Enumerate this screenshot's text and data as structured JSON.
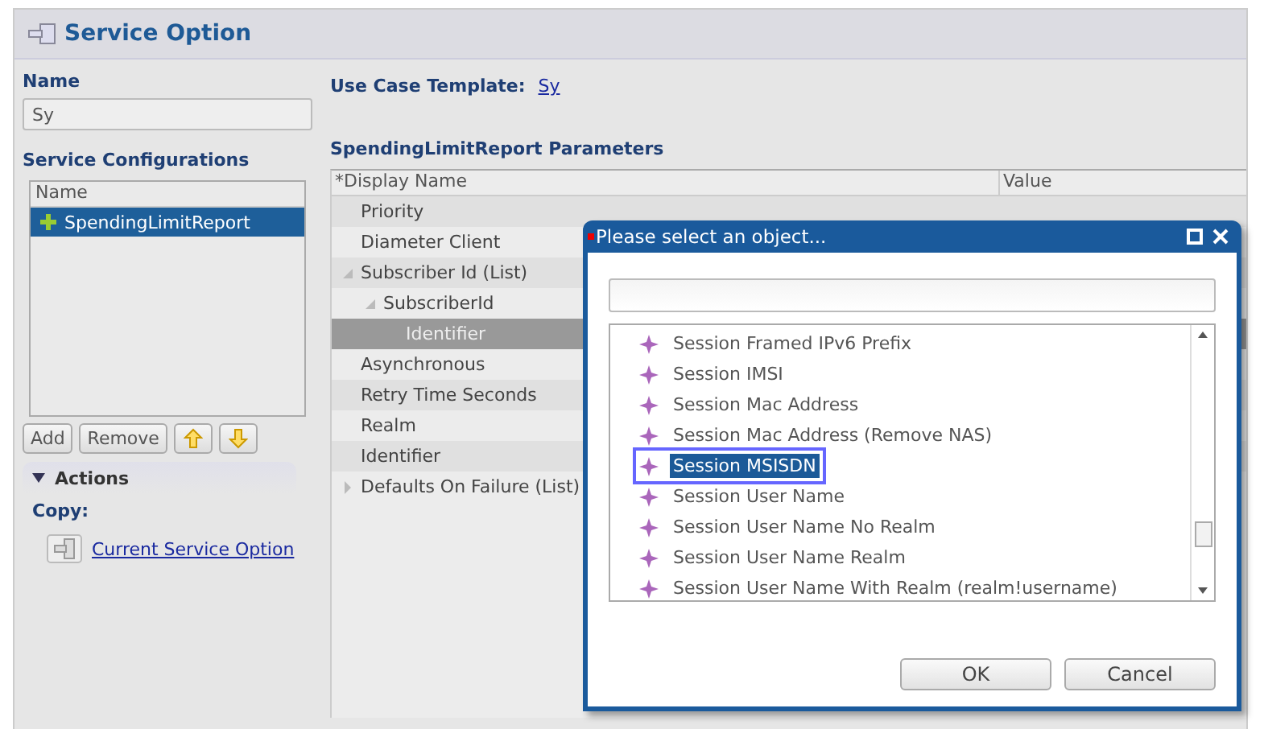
{
  "panel": {
    "title": "Service Option"
  },
  "name_field": {
    "label": "Name",
    "value": "Sy"
  },
  "use_case_template": {
    "label": "Use Case Template:",
    "link": "Sy"
  },
  "service_configurations": {
    "title": "Service Configurations",
    "column": "Name",
    "items": [
      {
        "label": "SpendingLimitReport",
        "selected": true
      }
    ],
    "buttons": [
      {
        "kind": "text",
        "label": "Add"
      },
      {
        "kind": "text",
        "label": "Remove"
      },
      {
        "kind": "up"
      },
      {
        "kind": "down"
      }
    ]
  },
  "actions": {
    "title": "Actions",
    "expanded": true,
    "copy_label": "Copy:",
    "link": "Current Service Option"
  },
  "parameters": {
    "title": "SpendingLimitReport Parameters",
    "columns": [
      "*Display Name",
      "Value"
    ],
    "rows": [
      {
        "label": "Priority",
        "selected": false
      },
      {
        "label": "Diameter Client",
        "selected": false
      },
      {
        "label": "Subscriber Id (List)",
        "selected": false,
        "expanded": true,
        "children": [
          {
            "label": "SubscriberId",
            "selected": false,
            "expanded": true,
            "children": [
              {
                "label": "Identifier",
                "selected": true
              }
            ]
          }
        ]
      },
      {
        "label": "Asynchronous",
        "selected": false
      },
      {
        "label": "Retry Time Seconds",
        "selected": false
      },
      {
        "label": "Realm",
        "selected": false
      },
      {
        "label": "Identifier",
        "selected": false
      },
      {
        "label": "Defaults On Failure (List)",
        "selected": false,
        "expanded": false
      }
    ]
  },
  "dialog": {
    "title": "Please select an object...",
    "items": [
      {
        "label": "Session Framed IPv6 Prefix",
        "selected": false
      },
      {
        "label": "Session IMSI",
        "selected": false
      },
      {
        "label": "Session Mac Address",
        "selected": false
      },
      {
        "label": "Session Mac Address (Remove NAS)",
        "selected": false
      },
      {
        "label": "Session MSISDN",
        "selected": true
      },
      {
        "label": "Session User Name",
        "selected": false
      },
      {
        "label": "Session User Name No Realm",
        "selected": false
      },
      {
        "label": "Session User Name Realm",
        "selected": false
      },
      {
        "label": "Session User Name With Realm (realm!username)",
        "selected": false
      }
    ],
    "buttons": [
      "OK",
      "Cancel"
    ]
  }
}
